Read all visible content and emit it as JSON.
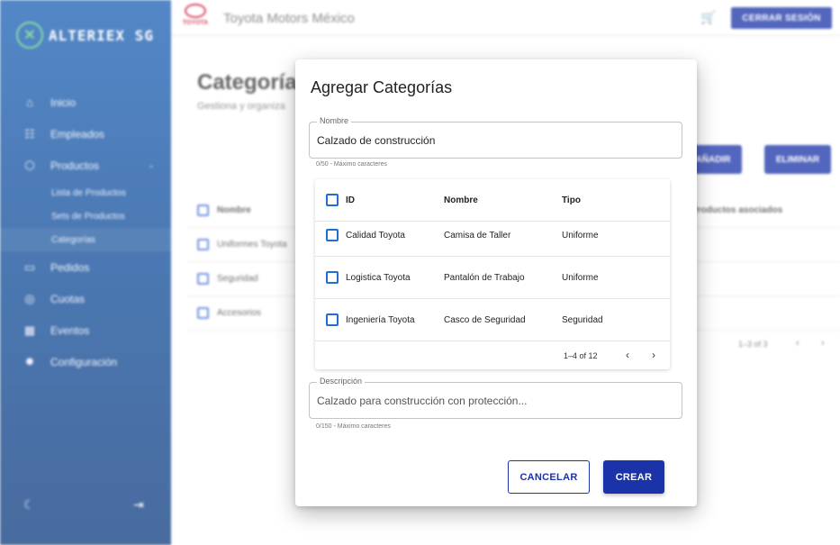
{
  "sidebar": {
    "logo_text": "ALTERIEX SG",
    "items": [
      {
        "label": "Inicio",
        "icon": "home-icon",
        "glyph": "⌂"
      },
      {
        "label": "Empleados",
        "icon": "people-icon",
        "glyph": "☷"
      },
      {
        "label": "Productos",
        "icon": "cube-icon",
        "glyph": "⬡",
        "chevron": "⌄"
      },
      {
        "label": "Pedidos",
        "icon": "inbox-icon",
        "glyph": "▭"
      },
      {
        "label": "Cuotas",
        "icon": "coin-icon",
        "glyph": "◎"
      },
      {
        "label": "Eventos",
        "icon": "calendar-icon",
        "glyph": "▦"
      },
      {
        "label": "Configuración",
        "icon": "gear-icon",
        "glyph": "✹"
      }
    ],
    "subitems": [
      "Lista de Productos",
      "Sets de Productos",
      "Categorías"
    ],
    "active_subitem": "Categorías",
    "moon_glyph": "☾",
    "logout_glyph": "⇥"
  },
  "topbar": {
    "brand_word": "TOYOTA",
    "company": "Toyota Motors México",
    "cart_glyph": "🛒",
    "logout_label": "CERRAR SESIÓN"
  },
  "page": {
    "title": "Categorías",
    "subtitle": "Gestiona y organiza",
    "add_label": "AÑADIR",
    "delete_label": "ELIMINAR",
    "table_headers": {
      "name": "Nombre",
      "assoc": "Productos asociados"
    },
    "rows": [
      "Uniformes Toyota",
      "Seguridad",
      "Accesorios"
    ],
    "pagination": "1–3 of 3",
    "prev_glyph": "‹",
    "next_glyph": "›"
  },
  "modal": {
    "title": "Agregar Categorías",
    "name_field": {
      "legend": "Nombre",
      "value": "Calzado de construcción",
      "helper": "0/50 - Máximo caracteres"
    },
    "grid": {
      "headers": {
        "id": "ID",
        "name": "Nombre",
        "type": "Tipo"
      },
      "rows": [
        {
          "id": "Calidad Toyota",
          "name": "Camisa de Taller",
          "type": "Uniforme"
        },
        {
          "id": "Logistica Toyota",
          "name": "Pantalón de Trabajo",
          "type": "Uniforme"
        },
        {
          "id": "Ingeniería Toyota",
          "name": "Casco de Seguridad",
          "type": "Seguridad"
        }
      ],
      "pagination": "1–4 of 12",
      "prev_glyph": "‹",
      "next_glyph": "›"
    },
    "description_field": {
      "legend": "Descripción",
      "value": "Calzado para construcción con protección...",
      "helper": "0/150 - Máximo caracteres"
    },
    "cancel_label": "CANCELAR",
    "create_label": "CREAR"
  }
}
